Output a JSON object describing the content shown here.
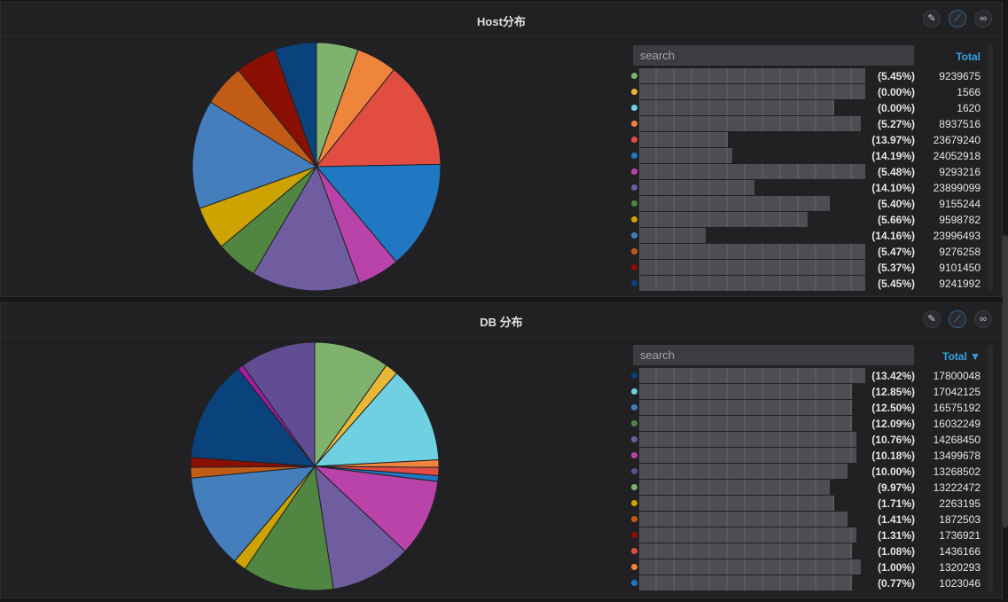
{
  "panels": [
    {
      "title": "Host分布",
      "search_placeholder": "search",
      "total_header": "Total",
      "rows": [
        {
          "pct": "(5.45%)",
          "value": "9239675",
          "color": "#7eb26d"
        },
        {
          "pct": "(0.00%)",
          "value": "1566",
          "color": "#eab839"
        },
        {
          "pct": "(0.00%)",
          "value": "1620",
          "color": "#6ed0e0"
        },
        {
          "pct": "(5.27%)",
          "value": "8937516",
          "color": "#ef843c"
        },
        {
          "pct": "(13.97%)",
          "value": "23679240",
          "color": "#e24d42"
        },
        {
          "pct": "(14.19%)",
          "value": "24052918",
          "color": "#1f78c1"
        },
        {
          "pct": "(5.48%)",
          "value": "9293216",
          "color": "#ba43a9"
        },
        {
          "pct": "(14.10%)",
          "value": "23899099",
          "color": "#705da0"
        },
        {
          "pct": "(5.40%)",
          "value": "9155244",
          "color": "#508642"
        },
        {
          "pct": "(5.66%)",
          "value": "9598782",
          "color": "#cca300"
        },
        {
          "pct": "(14.16%)",
          "value": "23996493",
          "color": "#447ebc"
        },
        {
          "pct": "(5.47%)",
          "value": "9276258",
          "color": "#c15c17"
        },
        {
          "pct": "(5.37%)",
          "value": "9101450",
          "color": "#890f02"
        },
        {
          "pct": "(5.45%)",
          "value": "9241992",
          "color": "#0a437c"
        }
      ]
    },
    {
      "title": "DB 分布",
      "search_placeholder": "search",
      "total_header": "Total ▼",
      "rows": [
        {
          "pct": "(13.42%)",
          "value": "17800048",
          "color": "#0a437c"
        },
        {
          "pct": "(12.85%)",
          "value": "17042125",
          "color": "#6ed0e0"
        },
        {
          "pct": "(12.50%)",
          "value": "16575192",
          "color": "#447ebc"
        },
        {
          "pct": "(12.09%)",
          "value": "16032249",
          "color": "#508642"
        },
        {
          "pct": "(10.76%)",
          "value": "14268450",
          "color": "#705da0"
        },
        {
          "pct": "(10.18%)",
          "value": "13499678",
          "color": "#ba43a9"
        },
        {
          "pct": "(10.00%)",
          "value": "13268502",
          "color": "#614d93"
        },
        {
          "pct": "(9.97%)",
          "value": "13222472",
          "color": "#7eb26d"
        },
        {
          "pct": "(1.71%)",
          "value": "2263195",
          "color": "#cca300"
        },
        {
          "pct": "(1.41%)",
          "value": "1872503",
          "color": "#c15c17"
        },
        {
          "pct": "(1.31%)",
          "value": "1736921",
          "color": "#890f02"
        },
        {
          "pct": "(1.08%)",
          "value": "1436166",
          "color": "#e24d42"
        },
        {
          "pct": "(1.00%)",
          "value": "1320293",
          "color": "#ef843c"
        },
        {
          "pct": "(0.77%)",
          "value": "1023046",
          "color": "#1f78c1"
        }
      ]
    }
  ],
  "chart_data": [
    {
      "type": "pie",
      "values": [
        9239675,
        1566,
        1620,
        8937516,
        23679240,
        24052918,
        9293216,
        23899099,
        9155244,
        9598782,
        23996493,
        9276258,
        9101450,
        9241992
      ],
      "colors": [
        "#7eb26d",
        "#eab839",
        "#6ed0e0",
        "#ef843c",
        "#e24d42",
        "#1f78c1",
        "#ba43a9",
        "#705da0",
        "#508642",
        "#cca300",
        "#447ebc",
        "#c15c17",
        "#890f02",
        "#0a437c"
      ]
    },
    {
      "type": "pie",
      "values": [
        13222472,
        2263195,
        17042125,
        1320293,
        1436166,
        1023046,
        13499678,
        14268450,
        16032249,
        2263195,
        16575192,
        1872503,
        1736921,
        17800048,
        1023046,
        13268502
      ],
      "colors": [
        "#7eb26d",
        "#eab839",
        "#6ed0e0",
        "#ef843c",
        "#e24d42",
        "#1f78c1",
        "#ba43a9",
        "#705da0",
        "#508642",
        "#cca300",
        "#447ebc",
        "#c15c17",
        "#890f02",
        "#0a437c",
        "#a21ba0",
        "#614d93"
      ]
    }
  ]
}
